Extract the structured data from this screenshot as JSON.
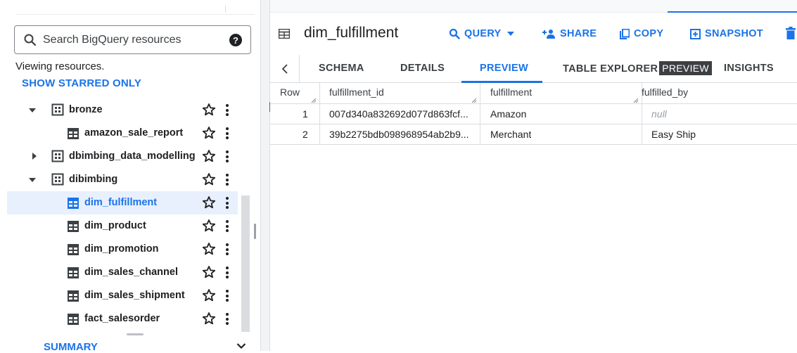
{
  "explorer": {
    "search_placeholder": "Search BigQuery resources",
    "viewing_text": "Viewing resources.",
    "show_starred_label": "SHOW STARRED ONLY",
    "items": [
      {
        "label": "bronze",
        "kind": "dataset",
        "expanded": true
      },
      {
        "label": "amazon_sale_report",
        "kind": "table"
      },
      {
        "label": "dbimbing_data_modelling",
        "kind": "dataset",
        "expanded": false
      },
      {
        "label": "dibimbing",
        "kind": "dataset",
        "expanded": true
      },
      {
        "label": "dim_fulfillment",
        "kind": "table",
        "selected": true
      },
      {
        "label": "dim_product",
        "kind": "table"
      },
      {
        "label": "dim_promotion",
        "kind": "table"
      },
      {
        "label": "dim_sales_channel",
        "kind": "table"
      },
      {
        "label": "dim_sales_shipment",
        "kind": "table"
      },
      {
        "label": "fact_salesorder",
        "kind": "table"
      }
    ],
    "summary_label": "SUMMARY"
  },
  "main": {
    "table_title": "dim_fulfillment",
    "actions": {
      "query": "QUERY",
      "share": "SHARE",
      "copy": "COPY",
      "snapshot": "SNAPSHOT"
    },
    "tabs": {
      "schema": "SCHEMA",
      "details": "DETAILS",
      "preview": "PREVIEW",
      "table_explorer": "TABLE EXPLORER",
      "table_explorer_badge": "PREVIEW",
      "insights": "INSIGHTS"
    },
    "grid": {
      "headers": [
        "Row",
        "fulfillment_id",
        "fulfillment",
        "fulfilled_by"
      ],
      "rows": [
        {
          "row": "1",
          "fulfillment_id": "007d340a832692d077d863fcf...",
          "fulfillment": "Amazon",
          "fulfilled_by": "null"
        },
        {
          "row": "2",
          "fulfillment_id": "39b2275bdb098968954ab2b9...",
          "fulfillment": "Merchant",
          "fulfilled_by": "Easy Ship"
        }
      ]
    }
  },
  "colors": {
    "accent": "#1a73e8",
    "selected_bg": "#e8f0fe",
    "text": "#202124"
  }
}
